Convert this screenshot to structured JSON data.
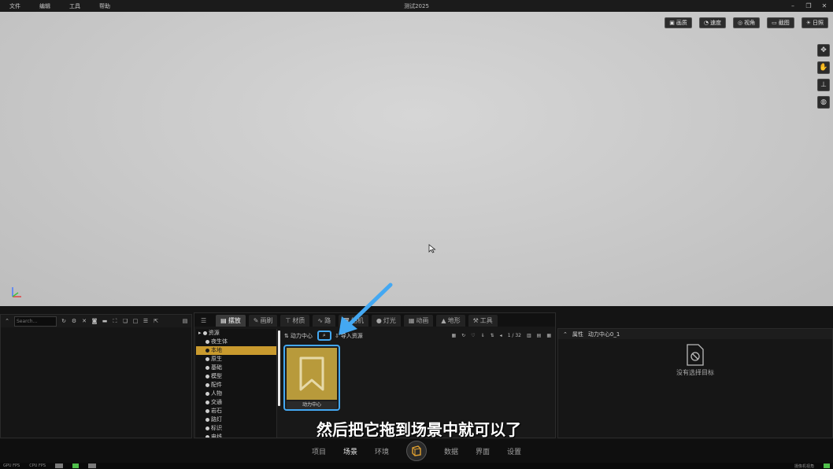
{
  "menubar": {
    "items": [
      "文件",
      "编辑",
      "工具",
      "帮助"
    ],
    "title": "测试2025",
    "controls": [
      "minimize-icon",
      "restore-icon",
      "close-icon"
    ]
  },
  "viewport": {
    "toolbar": [
      {
        "icon": "image-icon",
        "label": "画质"
      },
      {
        "icon": "speed-icon",
        "label": "速度"
      },
      {
        "icon": "view-icon",
        "label": "视角"
      },
      {
        "icon": "screenshot-icon",
        "label": "截图"
      },
      {
        "icon": "sun-icon",
        "label": "日照"
      }
    ],
    "side_tools": [
      "move-icon",
      "orbit-icon",
      "axis-icon",
      "globe-icon"
    ]
  },
  "left_panel": {
    "search_placeholder": "Search..."
  },
  "center_panel": {
    "tabs": [
      {
        "label": "摆放",
        "icon": "stack-icon",
        "active": true
      },
      {
        "label": "画刷",
        "icon": "brush-icon",
        "active": false
      },
      {
        "label": "材质",
        "icon": "material-icon",
        "active": false
      },
      {
        "label": "路",
        "icon": "road-icon",
        "active": false
      },
      {
        "label": "相机",
        "icon": "camera-icon",
        "active": false
      },
      {
        "label": "灯光",
        "icon": "light-icon",
        "active": false
      },
      {
        "label": "动画",
        "icon": "animation-icon",
        "active": false
      },
      {
        "label": "地形",
        "icon": "terrain-icon",
        "active": false
      },
      {
        "label": "工具",
        "icon": "wrench-icon",
        "active": false
      }
    ],
    "tree": {
      "root": "资源",
      "items": [
        "夜生体",
        "本地",
        "原生",
        "基础",
        "模型",
        "配件",
        "人物",
        "交通",
        "岩石",
        "路灯",
        "标识",
        "电线"
      ],
      "selected_index": 1
    },
    "asset_toolbar": {
      "path": "动力中心",
      "import_label": "导入资源",
      "page": "1 / 32"
    },
    "asset": {
      "name": "动力中心"
    },
    "subtitle": "然后把它拖到场景中就可以了"
  },
  "right_panel": {
    "header_label": "属性",
    "object_name": "动力中心0_1",
    "empty_text": "没有选择目标"
  },
  "bottom_nav": {
    "items": [
      "项目",
      "场景",
      "环境",
      "数据",
      "界面",
      "设置"
    ],
    "active": "场景"
  },
  "statusbar": {
    "fps": "GPU FPS",
    "mem": "CPU FPS",
    "cam": "摄像机视角"
  },
  "colors": {
    "accent_blue": "#44a8f2",
    "selection_gold": "#c99a2e",
    "asset_gold": "#b89a3b"
  }
}
